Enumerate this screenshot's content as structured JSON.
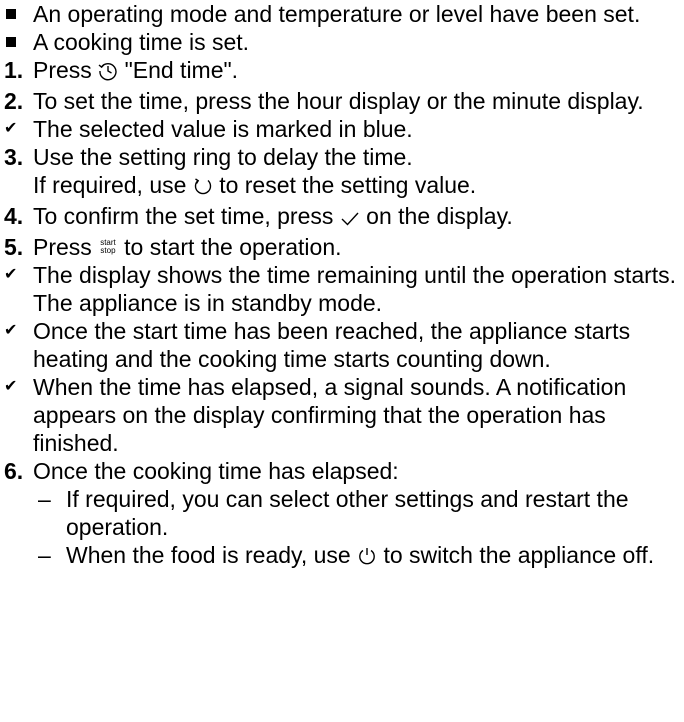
{
  "preconditions": [
    {
      "text": "An operating mode and temperature or level have been set."
    },
    {
      "text": "A cooking time is set."
    }
  ],
  "steps": {
    "s1": {
      "number": "1.",
      "before": "Press",
      "after": "\"End time\".",
      "icon": "clock-icon"
    },
    "s2": {
      "number": "2.",
      "text": "To set the time, press the hour display or the minute display."
    },
    "r1": {
      "text": "The selected value is marked in blue."
    },
    "s3": {
      "number": "3.",
      "line1": "Use the setting ring to delay the time.",
      "line2_before": "If required, use",
      "line2_after": "to reset the setting value.",
      "icon": "reset-icon"
    },
    "s4": {
      "number": "4.",
      "before": "To confirm the set time, press",
      "after": "on the display.",
      "icon": "checkmark-icon"
    },
    "s5": {
      "number": "5.",
      "before": "Press",
      "after": "to start the operation.",
      "icon_top": "start",
      "icon_bottom": "stop"
    },
    "r2": {
      "text": "The display shows the time remaining until the operation starts. The appliance is in standby mode."
    },
    "r3": {
      "text": "Once the start time has been reached, the appliance starts heating and the cooking time starts counting down."
    },
    "r4": {
      "text": "When the time has elapsed, a signal sounds. A notification appears on the display confirming that the operation has finished."
    },
    "s6": {
      "number": "6.",
      "text": "Once the cooking time has elapsed:",
      "sub": [
        {
          "dash": "–",
          "text": "If required, you can select other settings and restart the operation."
        },
        {
          "dash": "–",
          "before": "When the food is ready, use",
          "after": "to switch the appliance off.",
          "icon": "power-icon"
        }
      ]
    }
  },
  "check_mark": "✔"
}
